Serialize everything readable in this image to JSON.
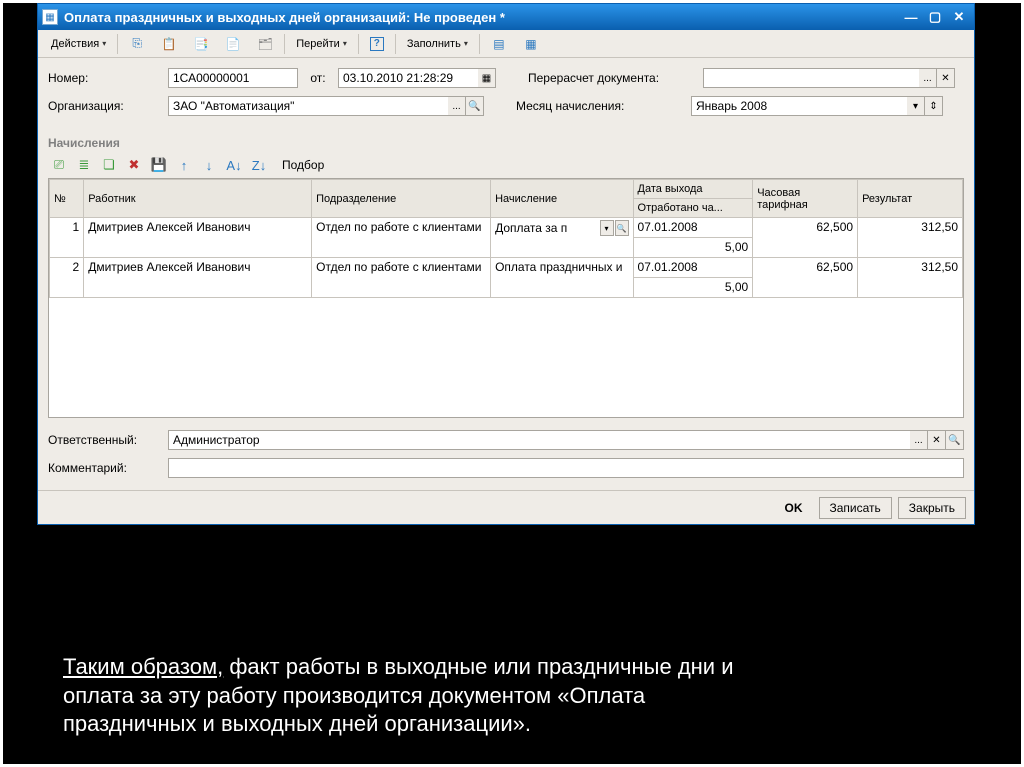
{
  "window": {
    "title": "Оплата праздничных и выходных дней организаций: Не проведен *"
  },
  "toolbar": {
    "actions": "Действия",
    "goto": "Перейти",
    "fill": "Заполнить"
  },
  "form": {
    "number_label": "Номер:",
    "number": "1СА00000001",
    "ot": "от:",
    "date": "03.10.2010 21:28:29",
    "org_label": "Организация:",
    "org": "ЗАО \"Автоматизация\"",
    "recalc_label": "Перерасчет документа:",
    "recalc": "",
    "month_label": "Месяц начисления:",
    "month": "Январь 2008"
  },
  "section_header": "Начисления",
  "mini_toolbar": {
    "podbor": "Подбор"
  },
  "columns": {
    "n": "№",
    "employee": "Работник",
    "dept": "Подразделение",
    "accrual": "Начисление",
    "date_out": "Дата выхода",
    "hours": "Отработано ча...",
    "rate": "Часовая тарифная",
    "result": "Результат"
  },
  "rows": [
    {
      "n": "1",
      "employee": "Дмитриев Алексей Иванович",
      "dept": "Отдел по работе с клиентами",
      "accrual": "Доплата за п",
      "date": "07.01.2008",
      "hours": "5,00",
      "rate": "62,500",
      "result": "312,50"
    },
    {
      "n": "2",
      "employee": "Дмитриев Алексей Иванович",
      "dept": "Отдел по работе с клиентами",
      "accrual": "Оплата праздничных и",
      "date": "07.01.2008",
      "hours": "5,00",
      "rate": "62,500",
      "result": "312,50"
    }
  ],
  "bottom": {
    "resp_label": "Ответственный:",
    "resp": "Администратор",
    "comment_label": "Комментарий:",
    "comment": ""
  },
  "footer": {
    "ok": "OK",
    "save": "Записать",
    "close": "Закрыть"
  },
  "caption": {
    "line1_a": "Таким образом,",
    "line1_b": " факт работы в выходные или праздничные дни и",
    "line2": "оплата за эту работу производится документом «Оплата",
    "line3": "праздничных и выходных дней организации»."
  }
}
